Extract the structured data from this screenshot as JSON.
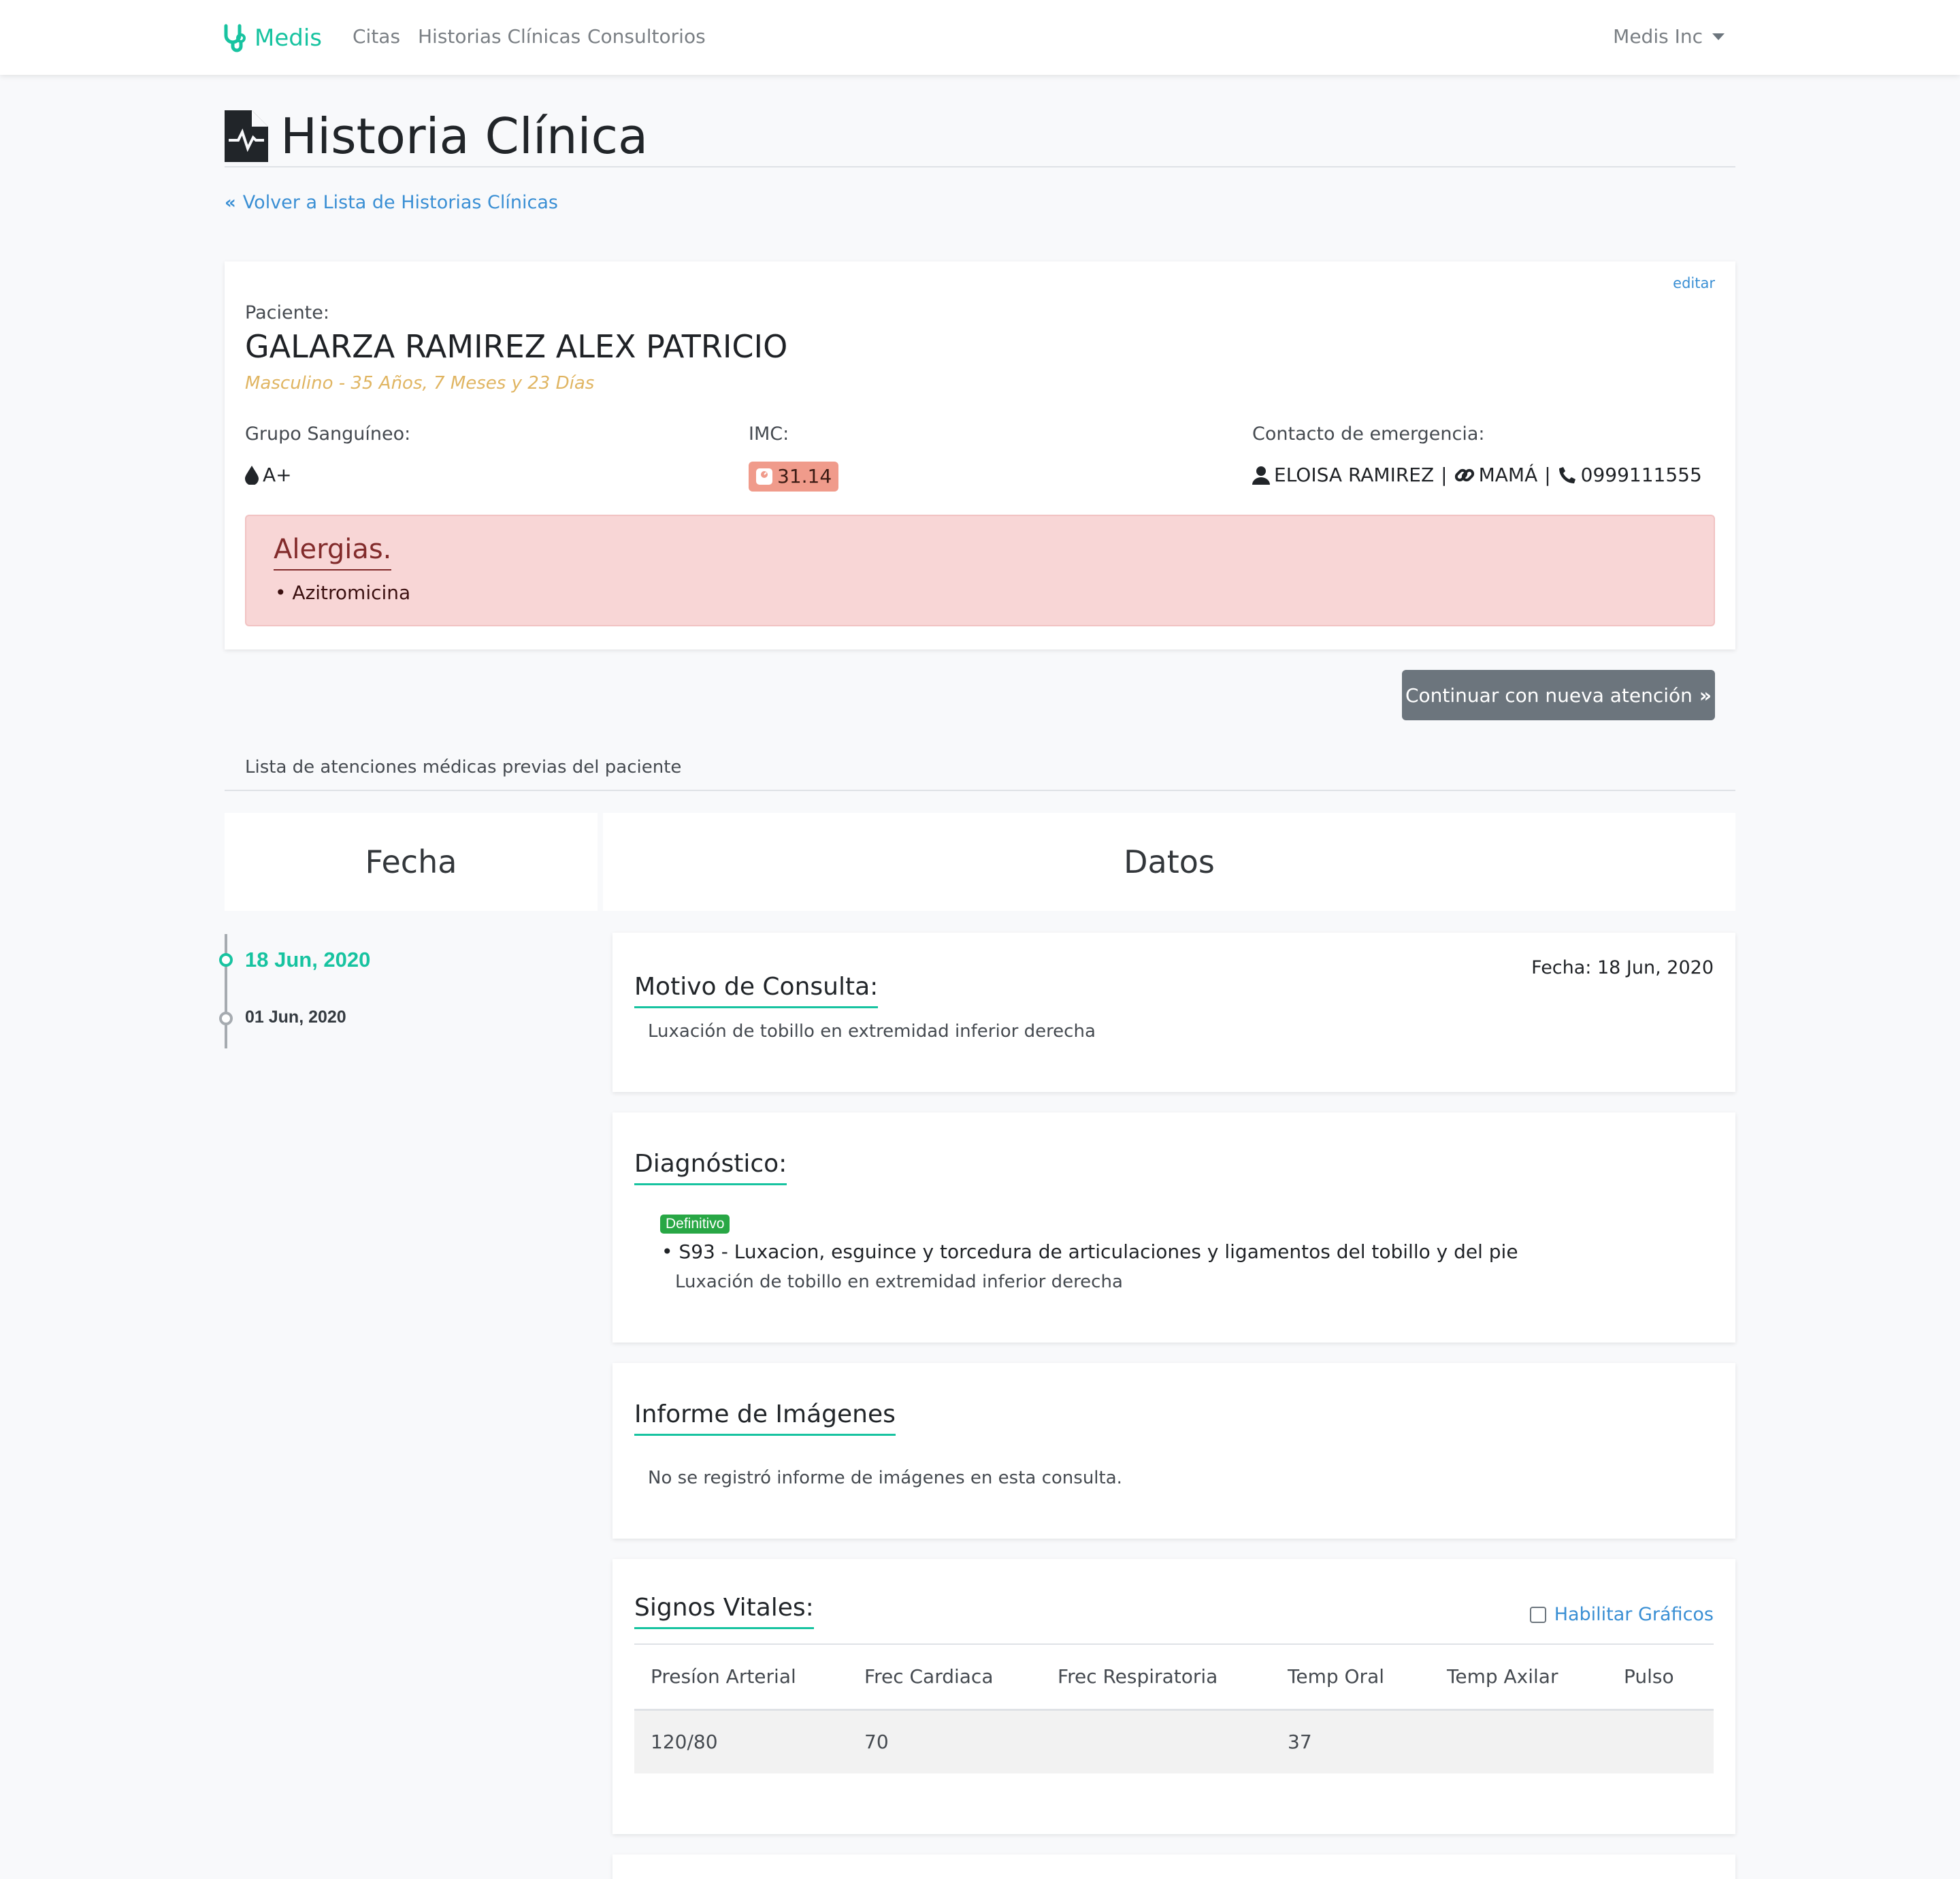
{
  "navbar": {
    "brand": "Medis",
    "links": [
      "Citas",
      "Historias Clínicas",
      "Consultorios"
    ],
    "user": "Medis Inc"
  },
  "page": {
    "title": "Historia Clínica",
    "back_link": "Volver a Lista de Historias Clínicas"
  },
  "patient": {
    "edit": "editar",
    "label": "Paciente:",
    "name": "GALARZA RAMIREZ ALEX PATRICIO",
    "subtitle": "Masculino - 35 Años, 7 Meses y 23 Días",
    "blood_label": "Grupo Sanguíneo:",
    "blood_value": "A+",
    "imc_label": "IMC:",
    "imc_value": "31.14",
    "emergency_label": "Contacto de emergencia:",
    "emergency_name": "ELOISA RAMIREZ",
    "emergency_relation": "MAMÁ",
    "emergency_phone": "0999111555",
    "separator": "|"
  },
  "allergies": {
    "title": "Alergias.",
    "items": [
      "• Azitromicina"
    ]
  },
  "actions": {
    "continue": "Continuar con nueva atención"
  },
  "history": {
    "caption": "Lista de atenciones médicas previas del paciente",
    "col_date": "Fecha",
    "col_data": "Datos",
    "dates": [
      "18 Jun, 2020",
      "01 Jun, 2020"
    ]
  },
  "consult": {
    "date_label": "Fecha: 18 Jun, 2020",
    "motivo_title": "Motivo de Consulta:",
    "motivo_text": "Luxación de tobillo en extremidad inferior derecha",
    "diag_title": "Diagnóstico:",
    "diag_badge": "Definitivo",
    "diag_item": "• S93 - Luxacion, esguince y torcedura de articulaciones y ligamentos del tobillo y del pie",
    "diag_note": "Luxación de tobillo en extremidad inferior derecha",
    "img_title": "Informe de Imágenes",
    "img_text": "No se registró informe de imágenes en esta consulta.",
    "vitals_title": "Signos Vitales:",
    "vitals_toggle": "Habilitar Gráficos",
    "vitals_headers": [
      "Presíon Arterial",
      "Frec Cardiaca",
      "Frec Respiratoria",
      "Temp Oral",
      "Temp Axilar",
      "Pulso"
    ],
    "vitals_row": [
      "120/80",
      "70",
      "",
      "37",
      "",
      ""
    ]
  },
  "colors": {
    "brand": "#17c3a0",
    "link": "#3a8fd4",
    "alert_bg": "#f8d6d6",
    "imc_badge": "#f09b8b",
    "button": "#6c757d",
    "badge_success": "#28a745"
  }
}
